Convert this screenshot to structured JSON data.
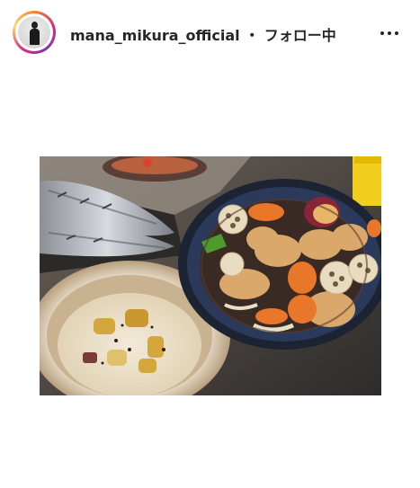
{
  "header": {
    "username": "mana_mikura_official",
    "separator": "・",
    "follow_status": "フォロー中",
    "more_icon": "more-horizontal-icon"
  },
  "post": {
    "photo_icon": "food-photo"
  },
  "colors": {
    "text": "#262626",
    "ring_gradient": [
      "#f58529",
      "#dd2a7b",
      "#8134af",
      "#feda77"
    ]
  }
}
